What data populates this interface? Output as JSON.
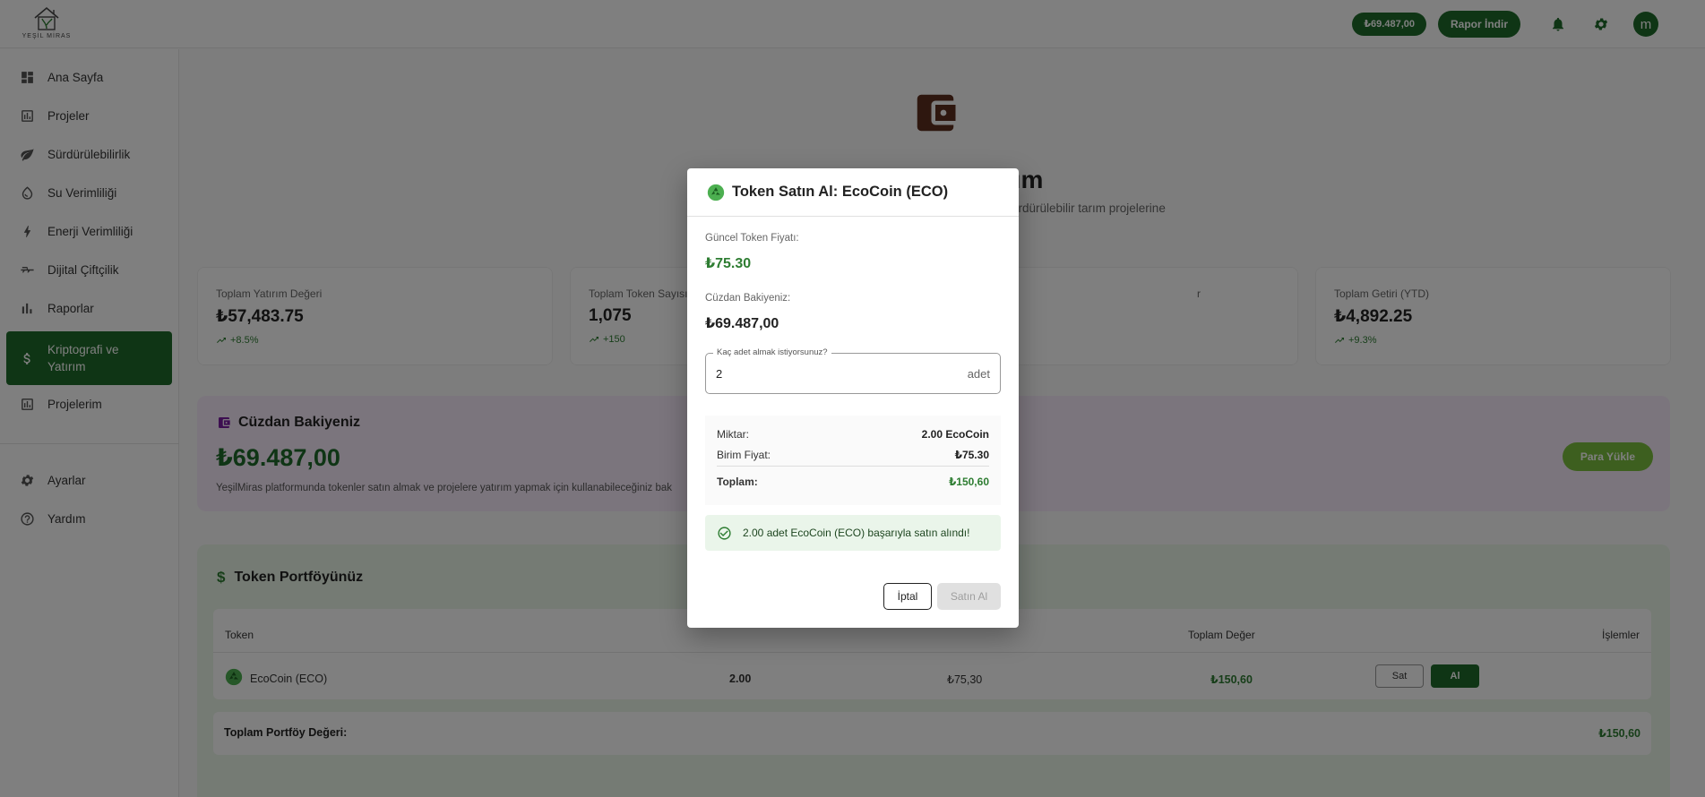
{
  "app": {
    "logo_text": "YEŞİL MİRAS",
    "balance_chip": "₺69.487,00",
    "report_button": "Rapor İndir",
    "avatar_letter": "m"
  },
  "sidebar": {
    "items": [
      {
        "label": "Ana Sayfa",
        "icon": "dashboard-icon"
      },
      {
        "label": "Projeler",
        "icon": "chart-icon"
      },
      {
        "label": "Sürdürülebilirlik",
        "icon": "leaf-icon"
      },
      {
        "label": "Su Verimliliği",
        "icon": "water-drop-icon"
      },
      {
        "label": "Enerji Verimliliği",
        "icon": "bolt-icon"
      },
      {
        "label": "Dijital Çiftçilik",
        "icon": "drone-icon"
      },
      {
        "label": "Raporlar",
        "icon": "bar-chart-icon"
      },
      {
        "label": "Kriptografi ve Yatırım",
        "icon": "dollar-icon",
        "active": true
      },
      {
        "label": "Projelerim",
        "icon": "chart-icon"
      }
    ],
    "bottom_items": [
      {
        "label": "Ayarlar",
        "icon": "gear-icon"
      },
      {
        "label": "Yardım",
        "icon": "help-icon"
      }
    ]
  },
  "main": {
    "hero_title_visible": "ırım",
    "hero_subtitle_visible": "ürdürülebilir tarım projelerine",
    "stats": [
      {
        "label": "Toplam Yatırım Değeri",
        "value": "₺57,483.75",
        "change": "+8.5%"
      },
      {
        "label": "Toplam Token Sayısı",
        "value": "1,075",
        "change": "+150"
      },
      {
        "label": "r",
        "value": "",
        "change": ""
      },
      {
        "label": "Toplam Getiri (YTD)",
        "value": "₺4,892.25",
        "change": "+9.3%"
      }
    ],
    "wallet": {
      "title": "Cüzdan Bakiyeniz",
      "amount": "₺69.487,00",
      "description": "YeşilMiras platformunda tokenler satın almak ve projelere yatırım yapmak için kullanabileceğiniz bak",
      "topup_button": "Para Yükle"
    },
    "portfolio": {
      "title": "Token Portföyünüz",
      "headers": {
        "token": "Token",
        "total_value": "Toplam Değer",
        "actions": "İşlemler"
      },
      "rows": [
        {
          "token": "EcoCoin (ECO)",
          "amount": "2.00",
          "price": "₺75,30",
          "total": "₺150,60",
          "sell": "Sat",
          "buy": "Al"
        }
      ],
      "total_label": "Toplam Portföy Değeri:",
      "total_value": "₺150,60"
    }
  },
  "modal": {
    "title": "Token Satın Al: EcoCoin (ECO)",
    "price_label": "Güncel Token Fiyatı:",
    "price_value": "₺75.30",
    "balance_label": "Cüzdan Bakiyeniz:",
    "balance_value": "₺69.487,00",
    "quantity_label": "Kaç adet almak istiyorsunuz?",
    "quantity_value": "2",
    "quantity_suffix": "adet",
    "summary": {
      "amount_label": "Miktar:",
      "amount_value": "2.00 EcoCoin",
      "unit_label": "Birim Fiyat:",
      "unit_value": "₺75.30",
      "total_label": "Toplam:",
      "total_value": "₺150,60"
    },
    "success_message": "2.00 adet EcoCoin (ECO) başarıyla satın alındı!",
    "cancel_button": "İptal",
    "submit_button": "Satın Al"
  },
  "colors": {
    "brand_green": "#1f6b2a",
    "success_green": "#2e7d32",
    "wallet_bg": "#f7ebfa",
    "portfolio_bg": "#eaf6e8",
    "wallet_icon": "#7b1fa2",
    "hero_icon": "#5d2e1e"
  }
}
